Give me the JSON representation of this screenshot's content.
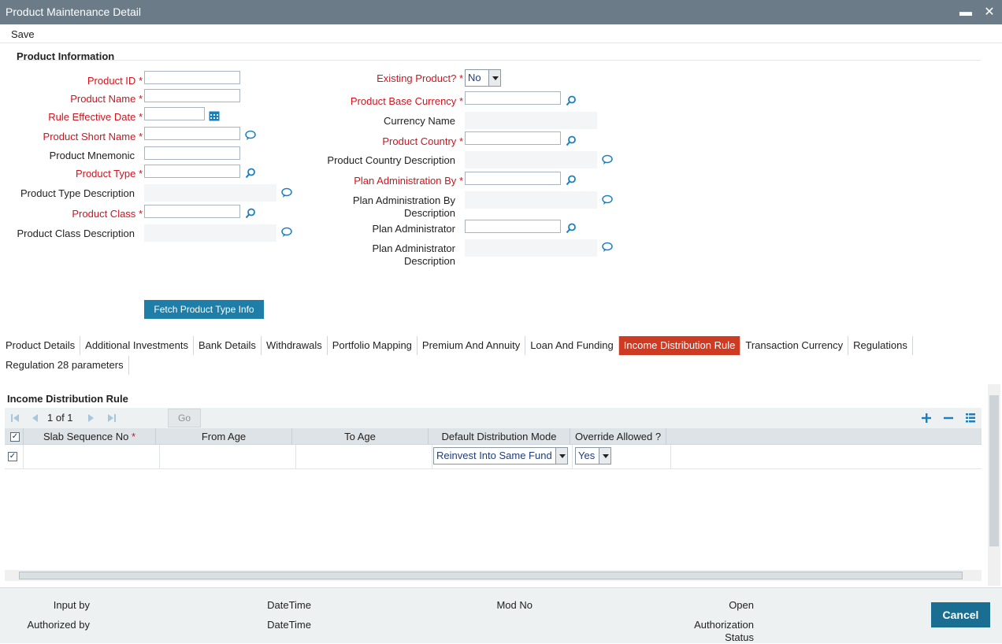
{
  "window": {
    "title": "Product Maintenance Detail",
    "minimize": "▬",
    "close": "✕"
  },
  "menu": {
    "save": "Save"
  },
  "product_info": {
    "section_title": "Product Information",
    "left": {
      "product_id": "Product ID",
      "product_name": "Product Name",
      "rule_effective_date": "Rule Effective Date",
      "product_short_name": "Product Short Name",
      "product_mnemonic": "Product Mnemonic",
      "product_type": "Product Type",
      "product_type_description": "Product Type Description",
      "product_class": "Product Class",
      "product_class_description": "Product Class Description"
    },
    "right": {
      "existing_product": "Existing Product?",
      "existing_product_value": "No",
      "product_base_currency": "Product Base Currency",
      "currency_name": "Currency Name",
      "product_country": "Product Country",
      "product_country_description": "Product Country Description",
      "plan_administration_by": "Plan Administration By",
      "plan_administration_by_desc_1": "Plan Administration By",
      "plan_administration_by_desc_2": "Description",
      "plan_administrator": "Plan Administrator",
      "plan_administrator_desc_1": "Plan Administrator",
      "plan_administrator_desc_2": "Description"
    },
    "required_mark": "*",
    "fetch_button": "Fetch Product Type Info"
  },
  "tabs": [
    "Product Details",
    "Additional Investments",
    "Bank Details",
    "Withdrawals",
    "Portfolio Mapping",
    "Premium And Annuity",
    "Loan And Funding",
    "Income Distribution Rule",
    "Transaction Currency",
    "Regulations"
  ],
  "tabs_row2": [
    "Regulation 28 parameters"
  ],
  "active_tab": "Income Distribution Rule",
  "income_distribution": {
    "section_title": "Income Distribution Rule",
    "pager": {
      "text": "1 of 1",
      "go": "Go"
    },
    "columns": [
      "Slab Sequence No",
      "From Age",
      "To Age",
      "Default Distribution Mode",
      "Override Allowed ?"
    ],
    "required_mark": "*",
    "rows": [
      {
        "checked": true,
        "slab": "",
        "from_age": "",
        "to_age": "",
        "mode": "Reinvest Into Same Fund",
        "override": "Yes"
      }
    ]
  },
  "footer": {
    "input_by": "Input by",
    "authorized_by": "Authorized by",
    "datetime1": "DateTime",
    "datetime2": "DateTime",
    "mod_no": "Mod No",
    "open": "Open",
    "authorization_status_1": "Authorization",
    "authorization_status_2": "Status",
    "cancel": "Cancel"
  },
  "colors": {
    "titlebar": "#6b7b87",
    "required": "#d0141e",
    "accent_blue": "#1e7ea8",
    "active_tab": "#cf3a22",
    "icon_blue": "#1a7fbf"
  },
  "icons": {
    "search": "search-icon",
    "comment": "comment-icon",
    "calendar": "calendar-icon"
  }
}
